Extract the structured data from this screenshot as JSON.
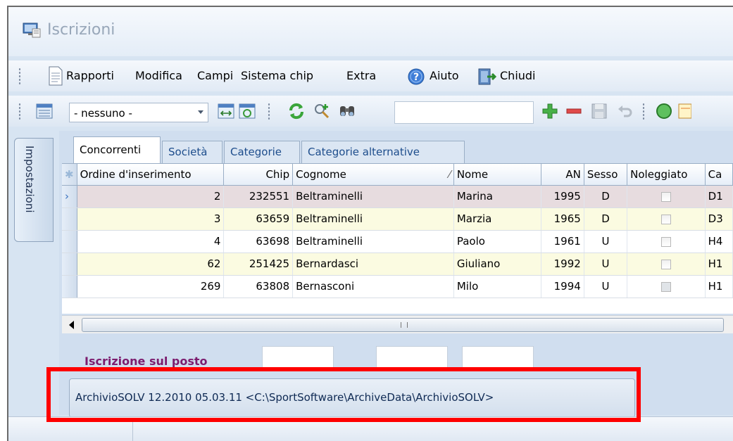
{
  "window": {
    "title": "Iscrizioni"
  },
  "menu": {
    "items": [
      "Rapporti",
      "Modifica",
      "Campi",
      "Sistema chip",
      "Extra",
      "Aiuto",
      "Chiudi"
    ]
  },
  "toolbar": {
    "filter_value": "- nessuno -",
    "search_value": ""
  },
  "side_tab": {
    "label": "Impostazioni"
  },
  "tabs": [
    {
      "label": "Concorrenti",
      "active": true
    },
    {
      "label": "Società",
      "active": false
    },
    {
      "label": "Categorie",
      "active": false
    },
    {
      "label": "Categorie alternative",
      "active": false
    }
  ],
  "grid": {
    "columns": [
      "Ordine d'inserimento",
      "Chip",
      "Cognome",
      "Nome",
      "AN",
      "Sesso",
      "Noleggiato",
      "Ca"
    ],
    "rows": [
      {
        "ordine": "2",
        "chip": "232551",
        "cognome": "Beltraminelli",
        "nome": "Marina",
        "an": "1995",
        "sesso": "D",
        "noleggiato": false,
        "cat": "D1"
      },
      {
        "ordine": "3",
        "chip": "63659",
        "cognome": "Beltraminelli",
        "nome": "Marzia",
        "an": "1965",
        "sesso": "D",
        "noleggiato": false,
        "cat": "D3"
      },
      {
        "ordine": "4",
        "chip": "63698",
        "cognome": "Beltraminelli",
        "nome": "Paolo",
        "an": "1961",
        "sesso": "U",
        "noleggiato": false,
        "cat": "H4"
      },
      {
        "ordine": "62",
        "chip": "251425",
        "cognome": "Bernardasci",
        "nome": "Giuliano",
        "an": "1992",
        "sesso": "U",
        "noleggiato": false,
        "cat": "H1"
      },
      {
        "ordine": "269",
        "chip": "63808",
        "cognome": "Bernasconi",
        "nome": "Milo",
        "an": "1994",
        "sesso": "U",
        "noleggiato": true,
        "cat": "H1"
      }
    ]
  },
  "entry": {
    "label": "Iscrizione sul posto"
  },
  "status": {
    "archive": "ArchivioSOLV 12.2010  05.03.11  <C:\\SportSoftware\\ArchiveData\\ArchivioSOLV>"
  }
}
